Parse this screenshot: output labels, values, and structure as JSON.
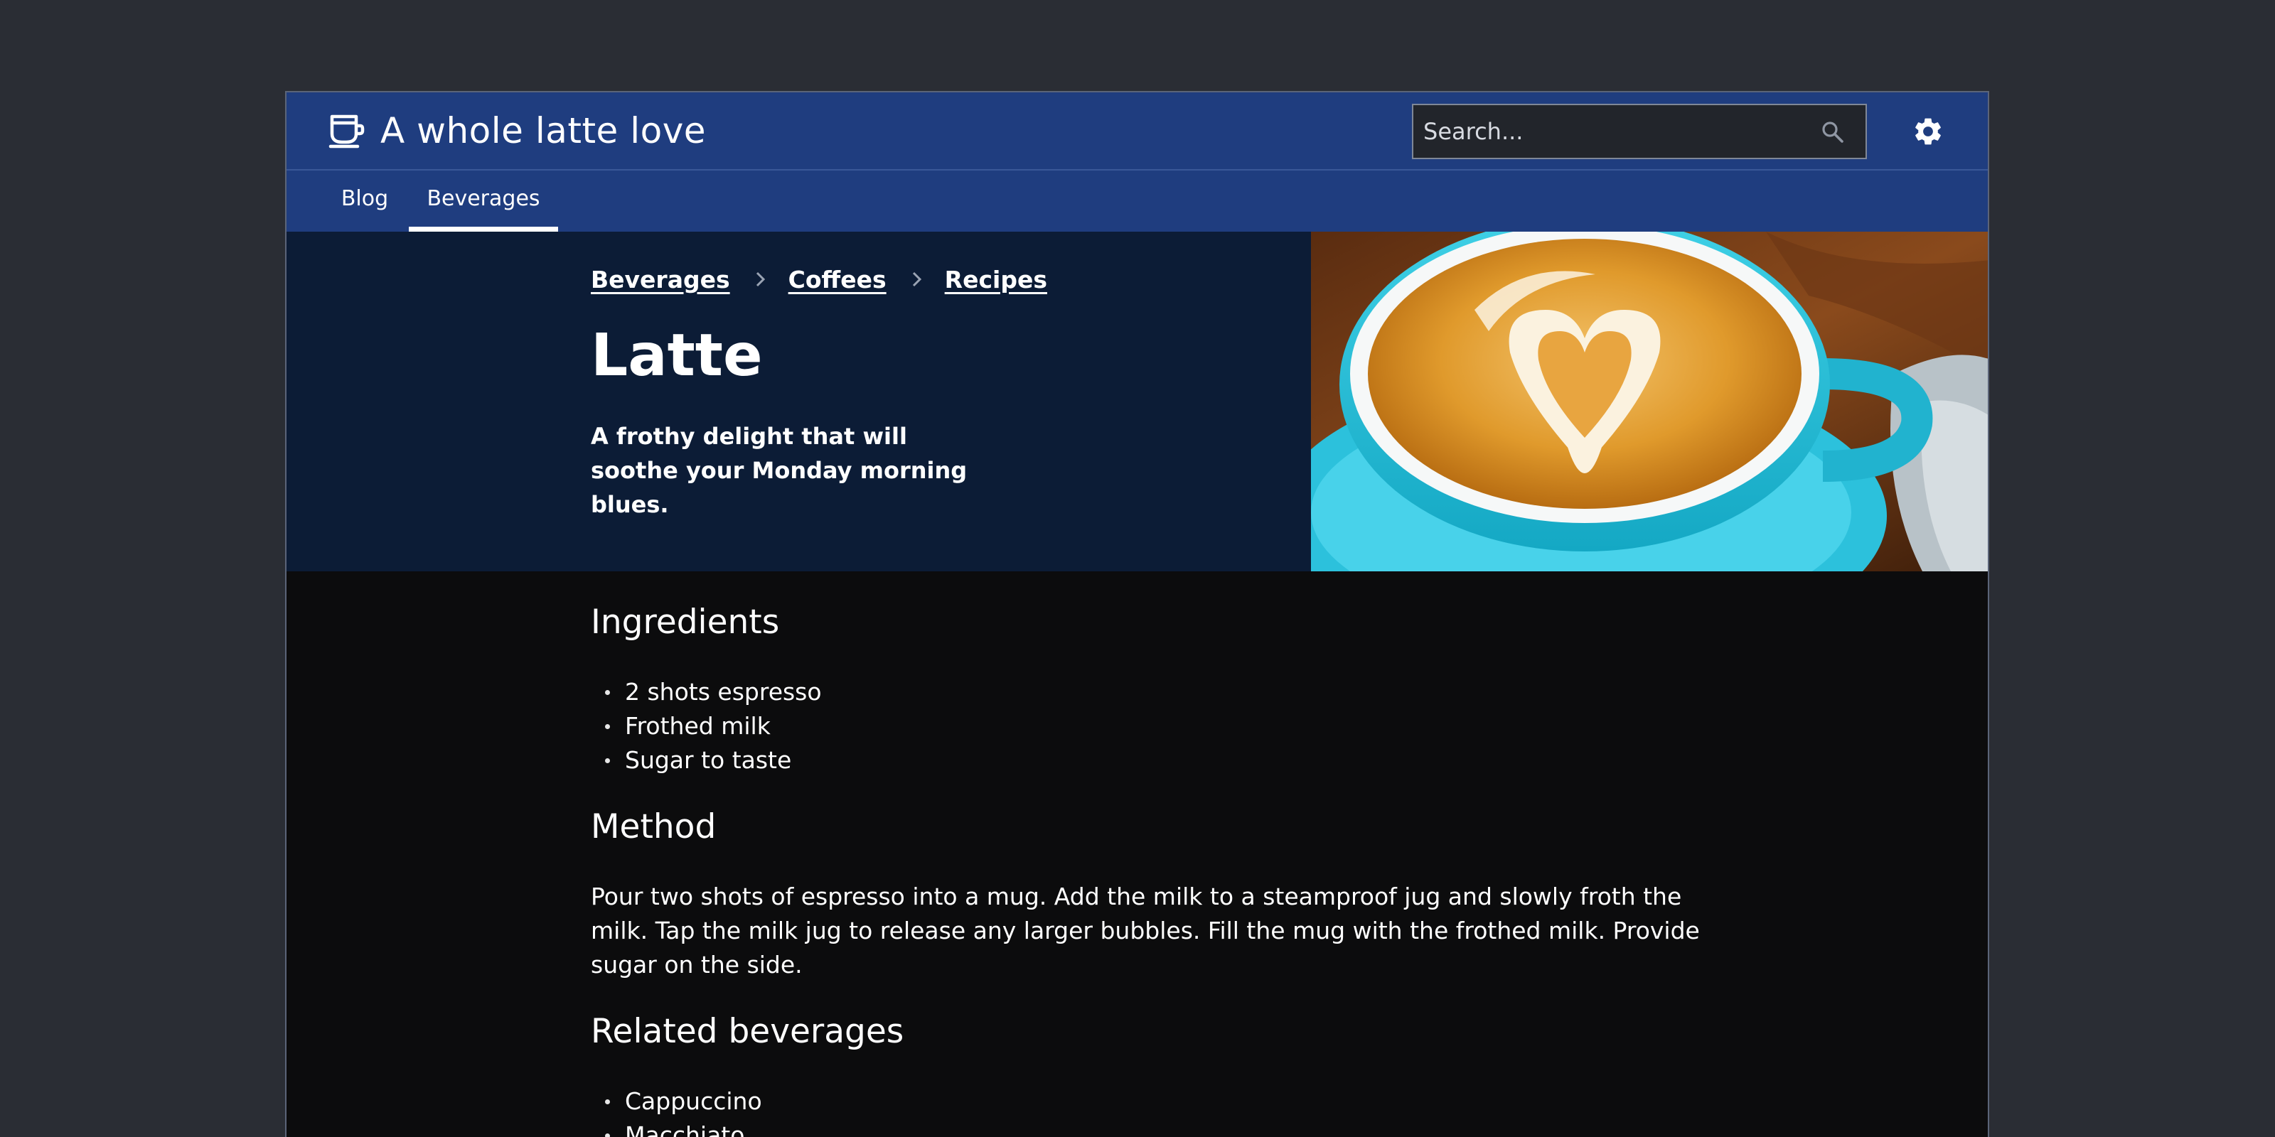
{
  "header": {
    "app_title": "A whole latte love",
    "search_placeholder": "Search...",
    "search_value": ""
  },
  "nav": {
    "tabs": [
      {
        "label": "Blog",
        "active": false
      },
      {
        "label": "Beverages",
        "active": true
      }
    ]
  },
  "hero": {
    "breadcrumb": [
      "Beverages",
      "Coffees",
      "Recipes"
    ],
    "title": "Latte",
    "subtitle": "A frothy delight that will soothe your Monday morning blues."
  },
  "content": {
    "ingredients_heading": "Ingredients",
    "ingredients": [
      "2 shots espresso",
      "Frothed milk",
      "Sugar to taste"
    ],
    "method_heading": "Method",
    "method_text": "Pour two shots of espresso into a mug. Add the milk to a steamproof jug and slowly froth the milk. Tap the milk jug to release any larger bubbles. Fill the mug with the frothed milk. Provide sugar on the side.",
    "related_heading": "Related beverages",
    "related": [
      "Cappuccino",
      "Macchiato"
    ]
  },
  "icons": {
    "logo": "coffee-cup-icon",
    "search": "search-icon",
    "settings": "gear-icon",
    "breadcrumb_separator": "chevron-right-icon"
  },
  "colors": {
    "page_background": "#2a2d34",
    "header_blue": "#1f3d7f",
    "hero_navy": "#0c1c36",
    "content_background": "#0c0c0d"
  }
}
